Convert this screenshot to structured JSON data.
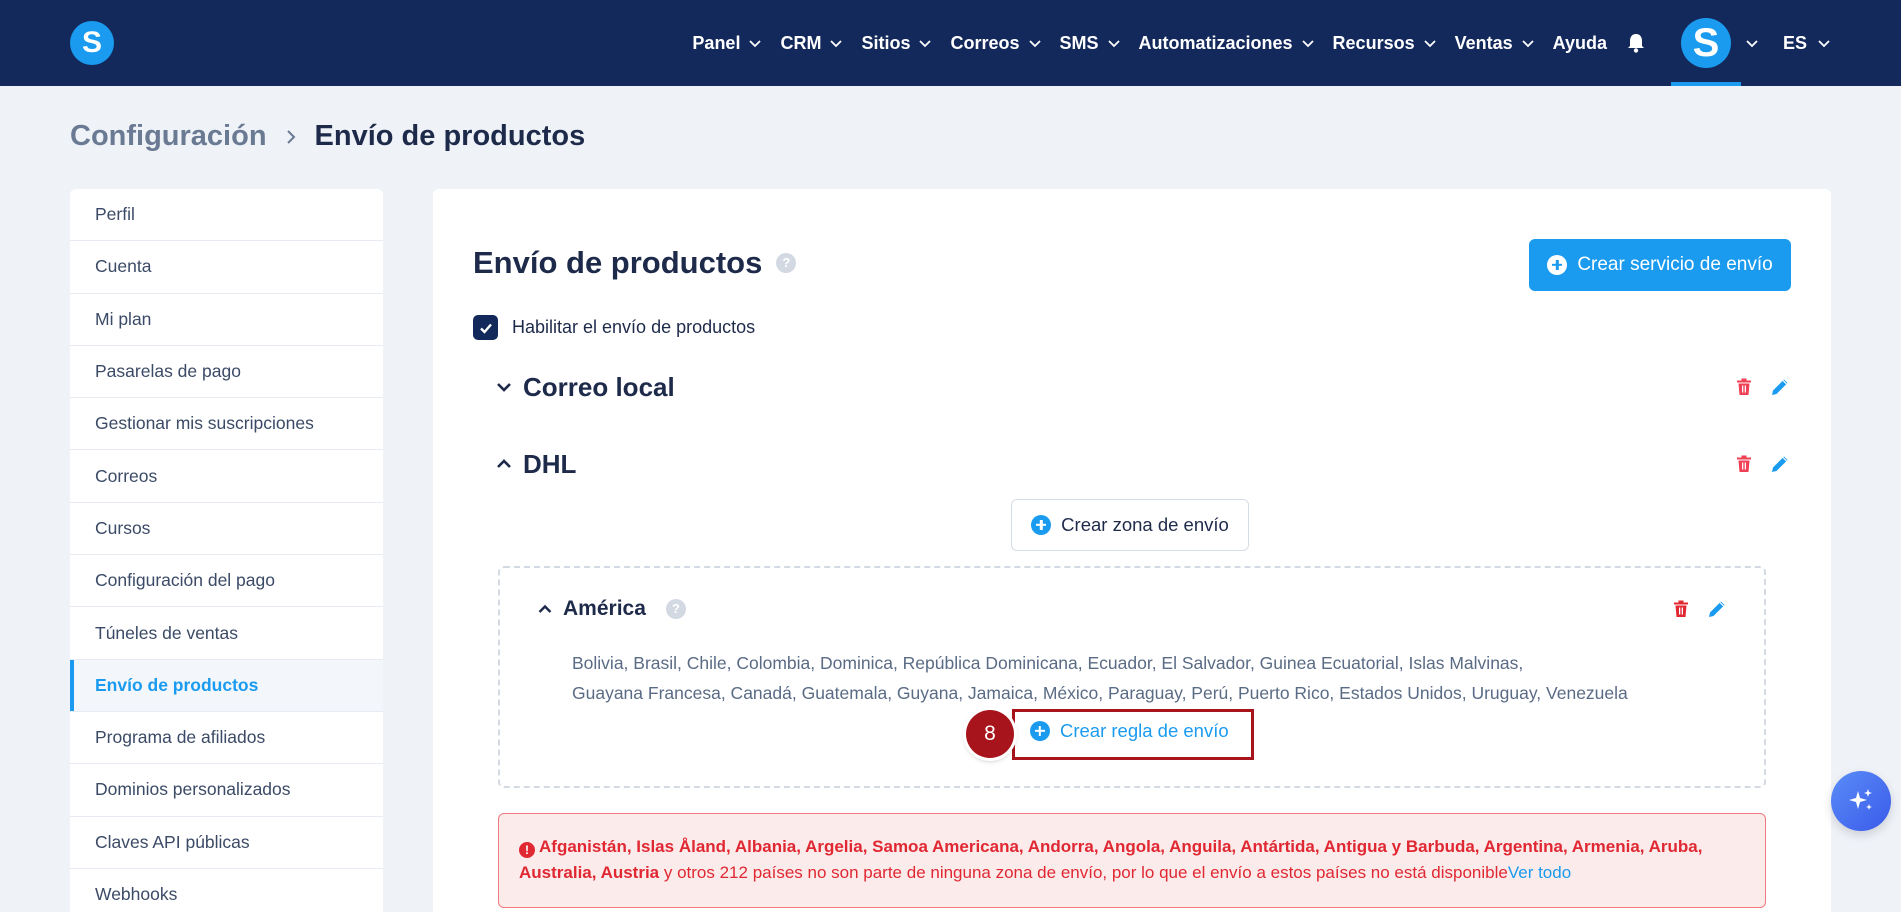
{
  "nav": {
    "logo_letter": "S",
    "items": [
      {
        "label": "Panel"
      },
      {
        "label": "CRM"
      },
      {
        "label": "Sitios"
      },
      {
        "label": "Correos"
      },
      {
        "label": "SMS"
      },
      {
        "label": "Automatizaciones"
      },
      {
        "label": "Recursos"
      },
      {
        "label": "Ventas"
      }
    ],
    "help_label": "Ayuda",
    "avatar_letter": "S",
    "language": "ES"
  },
  "breadcrumb": {
    "parent": "Configuración",
    "current": "Envío de productos"
  },
  "sidebar": {
    "items": [
      {
        "label": "Perfil"
      },
      {
        "label": "Cuenta"
      },
      {
        "label": "Mi plan"
      },
      {
        "label": "Pasarelas de pago"
      },
      {
        "label": "Gestionar mis suscripciones"
      },
      {
        "label": "Correos"
      },
      {
        "label": "Cursos"
      },
      {
        "label": "Configuración del pago"
      },
      {
        "label": "Túneles de ventas"
      },
      {
        "label": "Envío de productos"
      },
      {
        "label": "Programa de afiliados"
      },
      {
        "label": "Dominios personalizados"
      },
      {
        "label": "Claves API públicas"
      },
      {
        "label": "Webhooks"
      }
    ],
    "active_index": 9
  },
  "main": {
    "title": "Envío de productos",
    "help_glyph": "?",
    "create_service_label": "Crear servicio de envío",
    "enable_label": "Habilitar el envío de productos",
    "enable_checked": true,
    "services": [
      {
        "name": "Correo local",
        "expanded": false
      },
      {
        "name": "DHL",
        "expanded": true
      }
    ],
    "create_zone_label": "Crear zona de envío",
    "zone": {
      "name": "América",
      "countries_line1": "Bolivia, Brasil, Chile, Colombia, Dominica, República Dominicana, Ecuador, El Salvador, Guinea Ecuatorial, Islas Malvinas,",
      "countries_line2": "Guayana Francesa, Canadá, Guatemala, Guyana, Jamaica, México, Paraguay, Perú, Puerto Rico, Estados Unidos, Uruguay, Venezuela",
      "create_rule_label": "Crear regla de envío"
    },
    "step_number": "8",
    "alert": {
      "icon_glyph": "!",
      "bold_countries": "Afganistán, Islas Åland, Albania, Argelia, Samoa Americana, Andorra, Angola, Anguila, Antártida, Antigua y Barbuda, Argentina, Armenia, Aruba, Australia, Austria",
      "message": " y otros 212 países no son parte de ninguna zona de envío, por lo que el envío a estos países no está disponible",
      "link_label": "Ver todo"
    }
  },
  "colors": {
    "navbar": "#13295b",
    "accent": "#1a9bef",
    "danger": "#e02833",
    "highlight": "#a8141c"
  }
}
